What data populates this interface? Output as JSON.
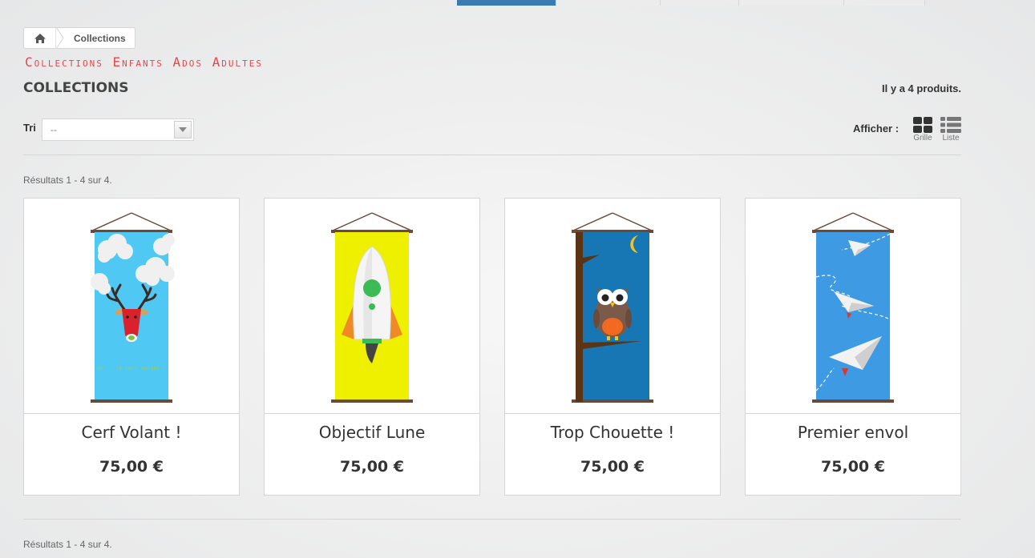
{
  "breadcrumb": {
    "home_icon": "home-icon",
    "current": "Collections"
  },
  "tagline": "Collections Enfants Ados Adultes",
  "page_title": "COLLECTIONS",
  "product_count": "Il y a 4 produits.",
  "sort": {
    "label": "Tri",
    "value": "--"
  },
  "display": {
    "label": "Afficher :",
    "grid_label": "Grille",
    "list_label": "Liste"
  },
  "results_top": "Résultats 1 - 4 sur 4.",
  "results_bottom": "Résultats 1 - 4 sur 4.",
  "products": [
    {
      "name": "Cerf Volant !",
      "price": "75,00 €",
      "caption": "OH... le Cerf volant !"
    },
    {
      "name": "Objectif Lune",
      "price": "75,00 €"
    },
    {
      "name": "Trop Chouette !",
      "price": "75,00 €"
    },
    {
      "name": "Premier envol",
      "price": "75,00 €"
    }
  ],
  "colors": {
    "accent_blue": "#3a7bb1",
    "tagline_red": "#e6474e",
    "panel_sky": "#4fc8f4",
    "panel_yellow": "#eef000",
    "panel_night": "#1677b4",
    "panel_blue": "#3f9ae4"
  }
}
